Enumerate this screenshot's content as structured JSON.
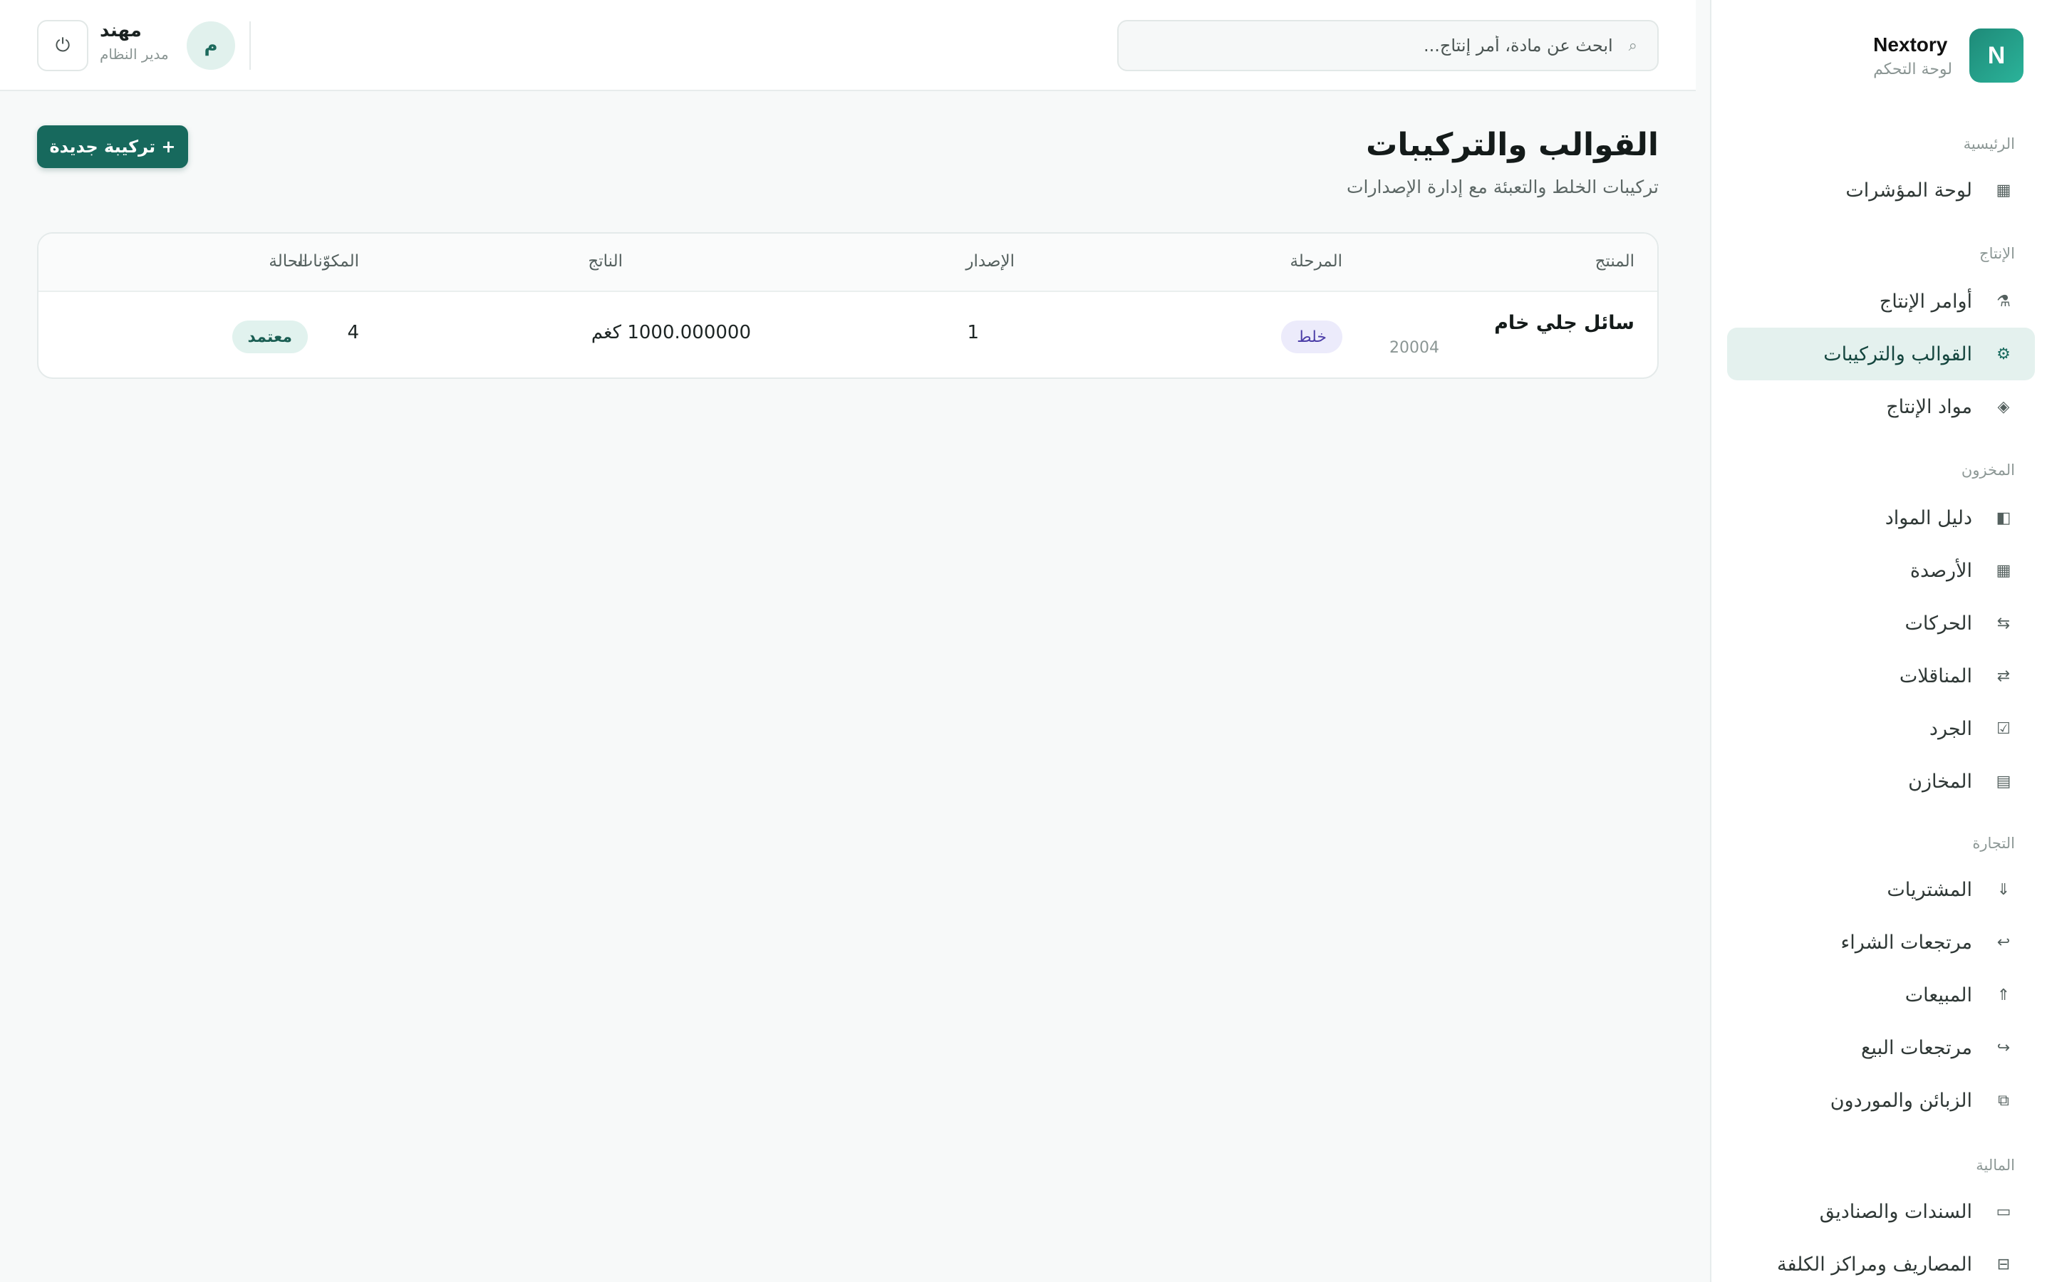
{
  "brand": {
    "logo_letter": "N",
    "name": "Nextory",
    "subtitle": "لوحة التحكم"
  },
  "sidebar": {
    "sections": [
      {
        "title": "الرئيسية",
        "items": [
          {
            "label": "لوحة المؤشرات",
            "icon": "grid-icon"
          }
        ]
      },
      {
        "title": "الإنتاج",
        "items": [
          {
            "label": "أوامر الإنتاج",
            "icon": "factory-icon"
          },
          {
            "label": "القوالب والتركيبات",
            "icon": "gear-icon",
            "active": true
          },
          {
            "label": "مواد الإنتاج",
            "icon": "diamond-icon"
          }
        ]
      },
      {
        "title": "المخزون",
        "items": [
          {
            "label": "دليل المواد",
            "icon": "book-icon"
          },
          {
            "label": "الأرصدة",
            "icon": "grid-icon"
          },
          {
            "label": "الحركات",
            "icon": "movements-icon"
          },
          {
            "label": "المناقلات",
            "icon": "transfer-icon"
          },
          {
            "label": "الجرد",
            "icon": "checkbox-icon"
          },
          {
            "label": "المخازن",
            "icon": "warehouse-icon"
          }
        ]
      },
      {
        "title": "التجارة",
        "items": [
          {
            "label": "المشتريات",
            "icon": "arrow-down-icon"
          },
          {
            "label": "مرتجعات الشراء",
            "icon": "return-left-icon"
          },
          {
            "label": "المبيعات",
            "icon": "arrow-up-icon"
          },
          {
            "label": "مرتجعات البيع",
            "icon": "return-right-icon"
          },
          {
            "label": "الزبائن والموردون",
            "icon": "contacts-icon"
          }
        ]
      },
      {
        "title": "المالية",
        "items": [
          {
            "label": "السندات والصناديق",
            "icon": "cash-icon"
          },
          {
            "label": "المصاريف ومراكز الكلفة",
            "icon": "ledger-icon"
          }
        ]
      }
    ]
  },
  "topbar": {
    "search_placeholder": "ابحث عن مادة، أمر إنتاج...",
    "user": {
      "initial": "م",
      "name": "مهند",
      "role": "مدير النظام"
    }
  },
  "page": {
    "title": "القوالب والتركيبات",
    "subtitle": "تركيبات الخلط والتعبئة مع إدارة الإصدارات",
    "new_button_label": "+  تركيبة جديدة"
  },
  "table": {
    "headers": {
      "product": "المنتج",
      "stage": "المرحلة",
      "version": "الإصدار",
      "output": "الناتج",
      "components": "المكوّنات",
      "status": "الحالة"
    },
    "rows": [
      {
        "product": "سائل جلي خام",
        "code": "20004",
        "stage": "خلط",
        "version": "1",
        "output": "1000.000000 كغم",
        "components": "4",
        "status": "معتمد"
      }
    ]
  }
}
